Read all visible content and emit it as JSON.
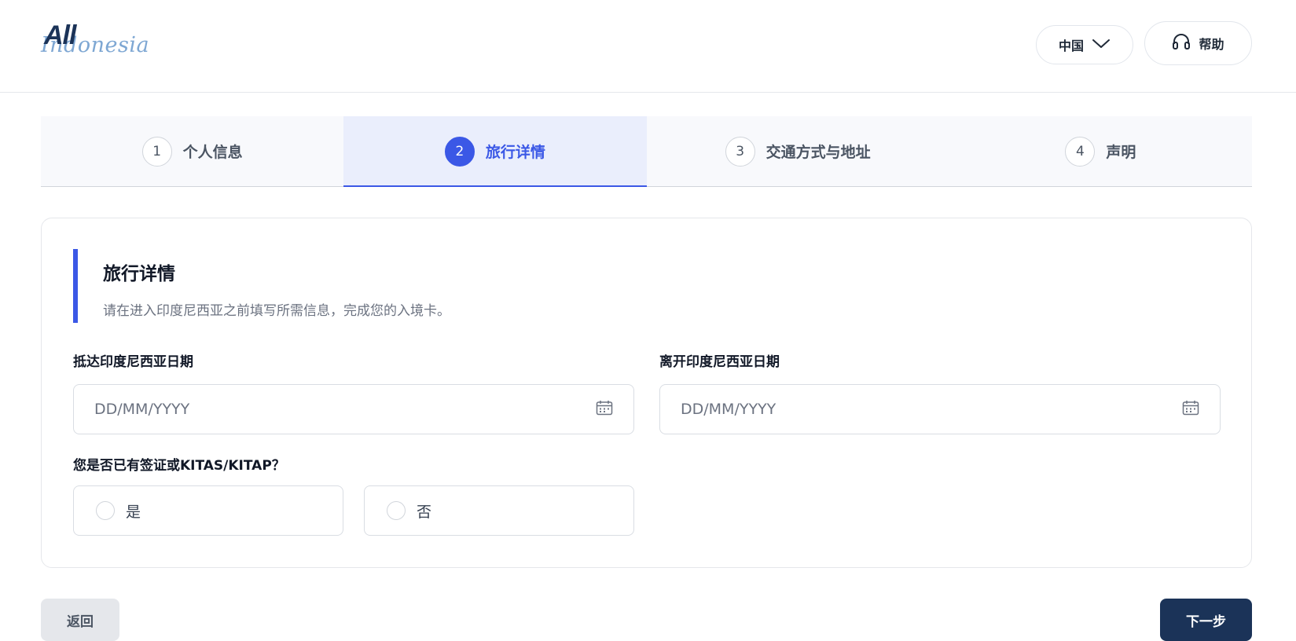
{
  "header": {
    "logo_all": "All",
    "logo_indonesia": "Indonesia",
    "language": "中国",
    "help": "帮助"
  },
  "steps": [
    {
      "num": "1",
      "label": "个人信息"
    },
    {
      "num": "2",
      "label": "旅行详情"
    },
    {
      "num": "3",
      "label": "交通方式与地址"
    },
    {
      "num": "4",
      "label": "声明"
    }
  ],
  "section": {
    "title": "旅行详情",
    "description": "请在进入印度尼西亚之前填写所需信息，完成您的入境卡。"
  },
  "form": {
    "arrival_label": "抵达印度尼西亚日期",
    "arrival_placeholder": "DD/MM/YYYY",
    "departure_label": "离开印度尼西亚日期",
    "departure_placeholder": "DD/MM/YYYY",
    "visa_question": "您是否已有签证或KITAS/KITAP？",
    "option_yes": "是",
    "option_no": "否"
  },
  "actions": {
    "back": "返回",
    "next": "下一步"
  },
  "colors": {
    "accent": "#3b58e6",
    "navy": "#1b3358",
    "step_active_bg": "#eaeefc"
  }
}
